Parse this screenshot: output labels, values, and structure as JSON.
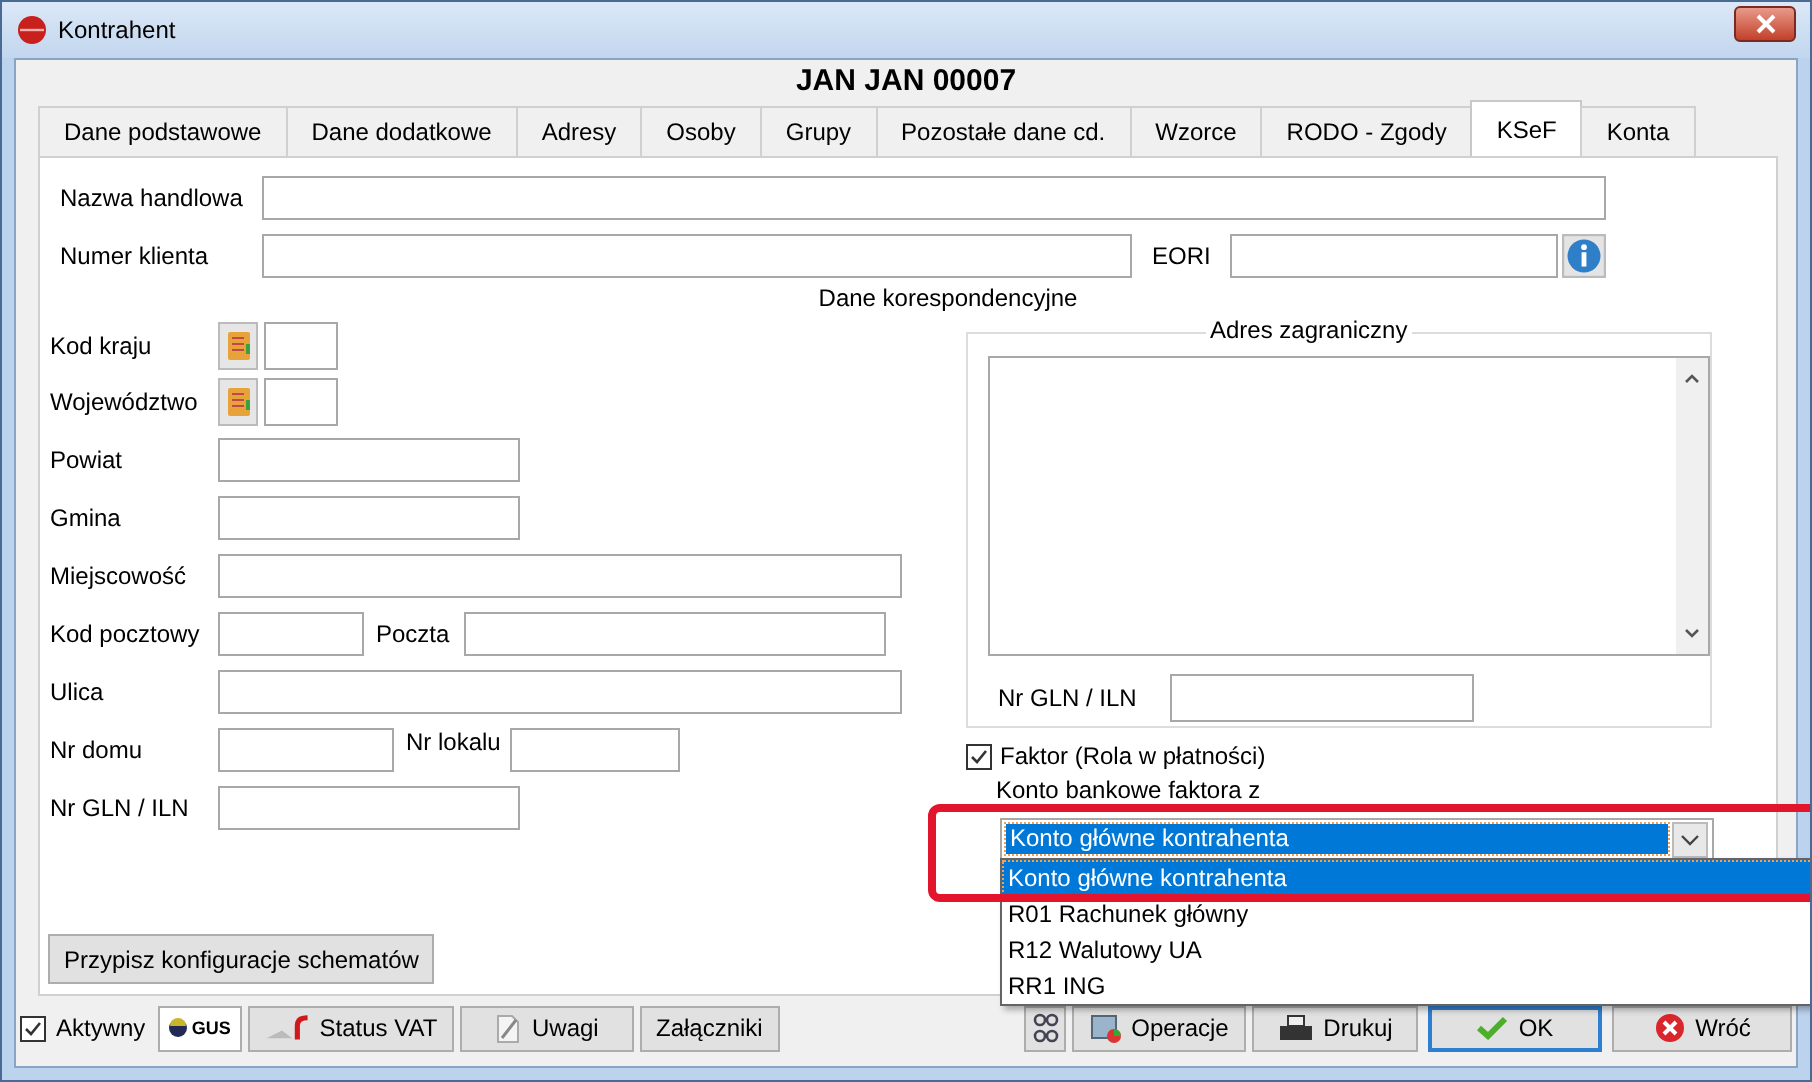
{
  "window": {
    "title": "Kontrahent"
  },
  "header": "JAN JAN 00007",
  "tabs": [
    {
      "label": "Dane podstawowe",
      "selected": false
    },
    {
      "label": "Dane dodatkowe",
      "selected": false
    },
    {
      "label": "Adresy",
      "selected": false
    },
    {
      "label": "Osoby",
      "selected": false
    },
    {
      "label": "Grupy",
      "selected": false
    },
    {
      "label": "Pozostałe dane cd.",
      "selected": false
    },
    {
      "label": "Wzorce",
      "selected": false
    },
    {
      "label": "RODO - Zgody",
      "selected": false
    },
    {
      "label": "KSeF",
      "selected": true
    },
    {
      "label": "Konta",
      "selected": false
    }
  ],
  "trade_name_label": "Nazwa handlowa",
  "client_number_label": "Numer klienta",
  "eori_label": "EORI",
  "section_title": "Dane korespondencyjne",
  "address_rows": [
    {
      "kind": "picker",
      "labels": [
        "Kod kraju"
      ]
    },
    {
      "kind": "picker",
      "labels": [
        "Województwo"
      ]
    },
    {
      "kind": "medium",
      "labels": [
        "Powiat"
      ]
    },
    {
      "kind": "medium",
      "labels": [
        "Gmina"
      ]
    },
    {
      "kind": "long",
      "labels": [
        "Miejscowość"
      ]
    },
    {
      "kind": "postal",
      "labels": [
        "Kod pocztowy",
        "Poczta"
      ]
    },
    {
      "kind": "long",
      "labels": [
        "Ulica"
      ]
    },
    {
      "kind": "house",
      "labels": [
        "Nr domu",
        "Nr lokalu"
      ]
    },
    {
      "kind": "medium",
      "labels": [
        "Nr GLN / ILN"
      ]
    }
  ],
  "foreign_address": {
    "title": "Adres zagraniczny",
    "gln_label": "Nr GLN / ILN"
  },
  "factor": {
    "label": "Faktor (Rola w płatności)",
    "checked": true
  },
  "bank_label": "Konto bankowe faktora z",
  "bank_combo": {
    "value": "Konto główne kontrahenta",
    "expanded": true,
    "highlighted": true,
    "options": [
      {
        "label": "Konto główne kontrahenta",
        "selected": true
      },
      {
        "label": "R01 Rachunek główny",
        "selected": false
      },
      {
        "label": "R12 Walutowy UA",
        "selected": false
      },
      {
        "label": "RR1 ING",
        "selected": false
      }
    ]
  },
  "assign_button": "Przypisz konfiguracje schematów",
  "footer": {
    "active": {
      "label": "Aktywny",
      "checked": true
    },
    "left_buttons": [
      {
        "kind": "gus",
        "label": "GUS"
      },
      {
        "kind": "vat",
        "label": "Status VAT"
      },
      {
        "kind": "notes",
        "label": "Uwagi"
      },
      {
        "kind": "plain",
        "label": "Załączniki"
      }
    ],
    "right_buttons": [
      {
        "kind": "tool"
      },
      {
        "kind": "operations",
        "label": "Operacje"
      },
      {
        "kind": "print",
        "label": "Drukuj"
      },
      {
        "kind": "ok",
        "label": "OK"
      },
      {
        "kind": "cancel",
        "label": "Wróć"
      }
    ]
  }
}
